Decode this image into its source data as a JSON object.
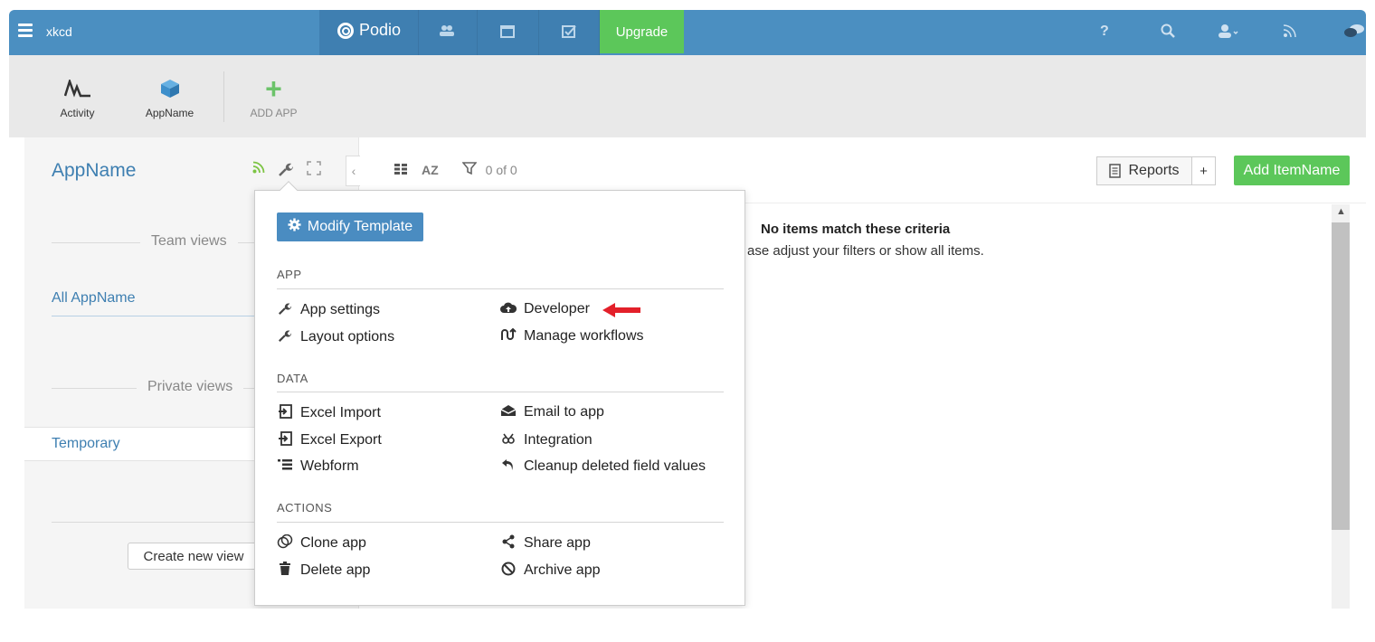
{
  "topbar": {
    "workspace": "xkcd",
    "brand": "Podio",
    "upgrade": "Upgrade"
  },
  "appbar": {
    "tiles": [
      {
        "label": "Activity"
      },
      {
        "label": "AppName"
      },
      {
        "label": "ADD APP"
      }
    ]
  },
  "sidebar": {
    "app_title": "AppName",
    "team_views_label": "Team views",
    "team_views": [
      "All AppName"
    ],
    "private_views_label": "Private views",
    "private_views": [
      "Temporary"
    ],
    "create_view": "Create new view"
  },
  "toolbar": {
    "sort_label": "AZ",
    "count": "0 of 0",
    "reports": "Reports",
    "reports_plus": "+",
    "add_item": "Add ItemName"
  },
  "main": {
    "empty_title": "No items match these criteria",
    "empty_sub": "ase adjust your filters or show all items."
  },
  "popover": {
    "modify_template": "Modify Template",
    "sections": {
      "app": {
        "title": "APP",
        "left": [
          "App settings",
          "Layout options"
        ],
        "right": [
          "Developer",
          "Manage workflows"
        ]
      },
      "data": {
        "title": "DATA",
        "left": [
          "Excel Import",
          "Excel Export",
          "Webform"
        ],
        "right": [
          "Email to app",
          "Integration",
          "Cleanup deleted field values"
        ]
      },
      "actions": {
        "title": "ACTIONS",
        "left": [
          "Clone app",
          "Delete app"
        ],
        "right": [
          "Share app",
          "Archive app"
        ]
      }
    }
  },
  "colors": {
    "topbar": "#4b8fc1",
    "accent_green": "#5cc75a",
    "link_blue": "#3e7fb1",
    "annotation_red": "#e3202a"
  }
}
